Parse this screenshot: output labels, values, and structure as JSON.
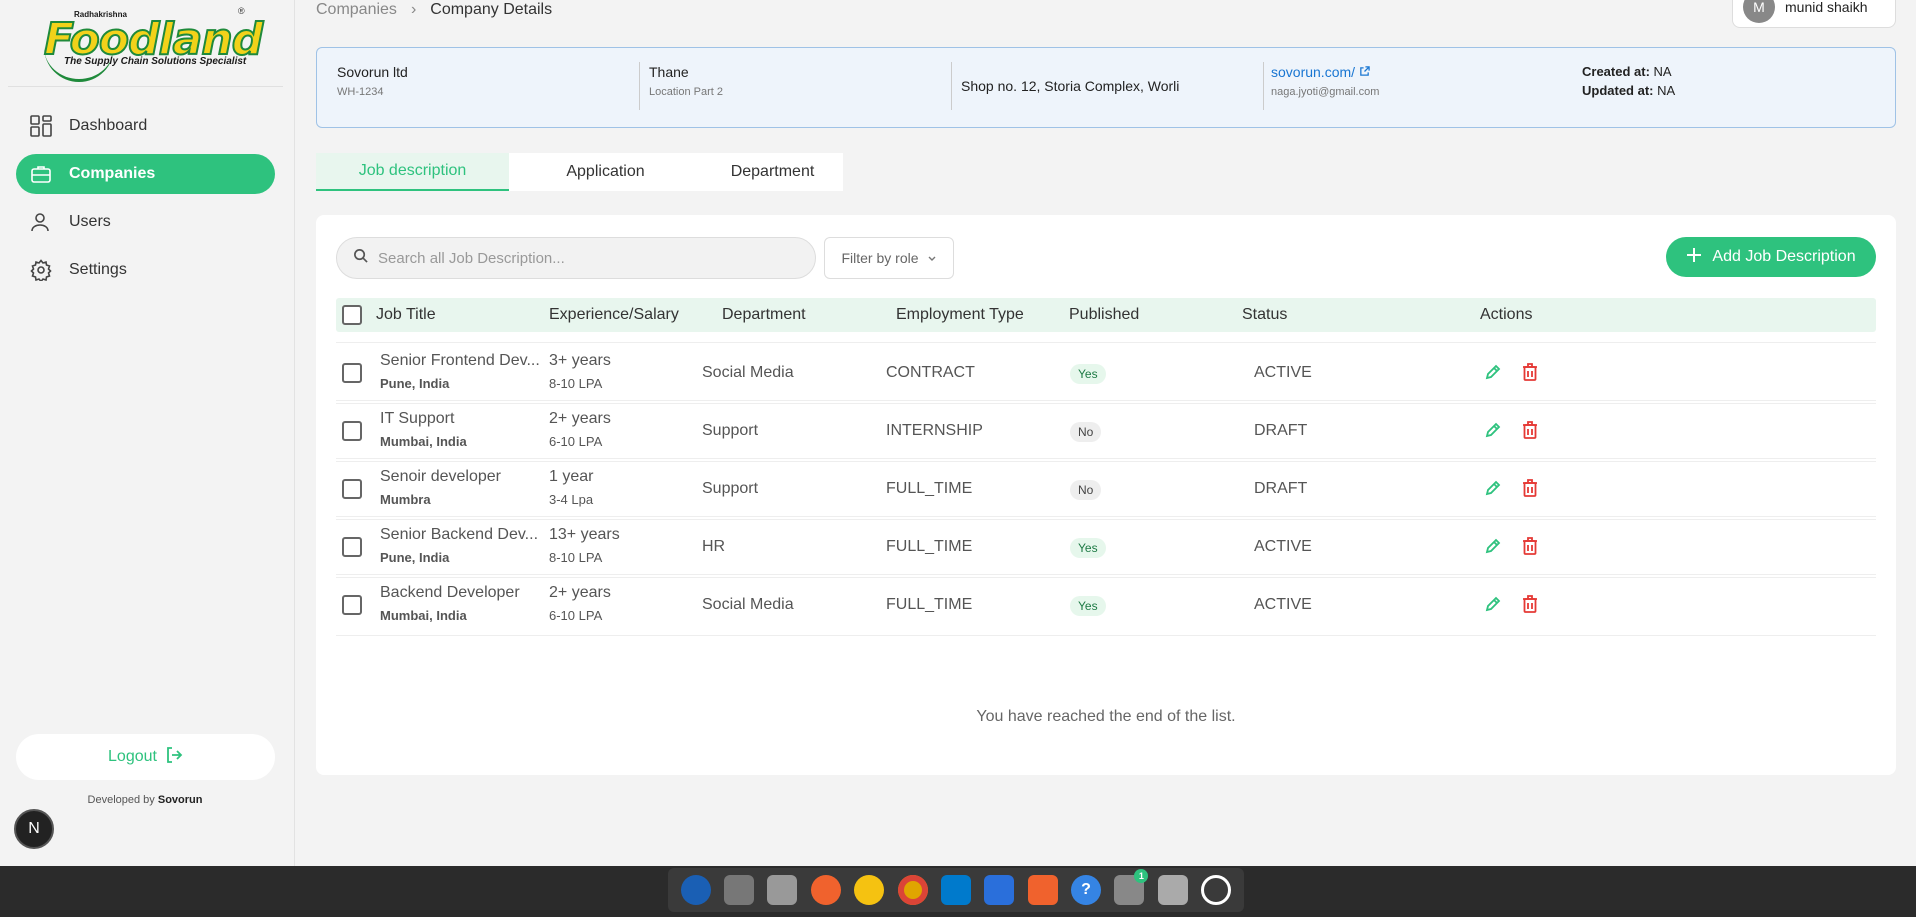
{
  "logo": {
    "small": "Radhakrishna",
    "brand": "Foodland",
    "reg": "®",
    "tagline": "The Supply Chain Solutions Specialist"
  },
  "sidebar": {
    "items": [
      {
        "label": "Dashboard",
        "icon": "dashboard-grid-icon"
      },
      {
        "label": "Companies",
        "icon": "briefcase-icon"
      },
      {
        "label": "Users",
        "icon": "user-icon"
      },
      {
        "label": "Settings",
        "icon": "gear-icon"
      }
    ],
    "logout": "Logout",
    "dev_prefix": "Developed by",
    "dev_name": "Sovorun",
    "badge": "N"
  },
  "breadcrumb": {
    "parent": "Companies",
    "sep": "›",
    "current": "Company Details"
  },
  "user": {
    "initial": "M",
    "name": "munid shaikh"
  },
  "company": {
    "name": "Sovorun ltd",
    "code": "WH-1234",
    "city": "Thane",
    "location": "Location Part 2",
    "address": "Shop no. 12, Storia Complex, Worli",
    "website": "sovorun.com/",
    "email": "naga.jyoti@gmail.com",
    "created_label": "Created at:",
    "created_value": "NA",
    "updated_label": "Updated at:",
    "updated_value": "NA"
  },
  "tabs": [
    "Job description",
    "Application",
    "Department"
  ],
  "toolbar": {
    "search_placeholder": "Search all Job Description...",
    "filter_label": "Filter by role",
    "add_label": "Add Job Description"
  },
  "table": {
    "headers": [
      "Job Title",
      "Experience/Salary",
      "Department",
      "Employment Type",
      "Published",
      "Status",
      "Actions"
    ],
    "rows": [
      {
        "title": "Senior Frontend Dev...",
        "location": "Pune, India",
        "exp": "3+ years",
        "salary": "8-10 LPA",
        "dept": "Social Media",
        "type": "CONTRACT",
        "published": "Yes",
        "status": "ACTIVE"
      },
      {
        "title": "IT Support",
        "location": "Mumbai, India",
        "exp": "2+ years",
        "salary": "6-10 LPA",
        "dept": "Support",
        "type": "INTERNSHIP",
        "published": "No",
        "status": "DRAFT"
      },
      {
        "title": "Senoir developer",
        "location": "Mumbra",
        "exp": "1 year",
        "salary": "3-4 Lpa",
        "dept": "Support",
        "type": "FULL_TIME",
        "published": "No",
        "status": "DRAFT"
      },
      {
        "title": "Senior Backend Dev...",
        "location": "Pune, India",
        "exp": "13+ years",
        "salary": "8-10 LPA",
        "dept": "HR",
        "type": "FULL_TIME",
        "published": "Yes",
        "status": "ACTIVE"
      },
      {
        "title": "Backend Developer",
        "location": "Mumbai, India",
        "exp": "2+ years",
        "salary": "6-10 LPA",
        "dept": "Social Media",
        "type": "FULL_TIME",
        "published": "Yes",
        "status": "ACTIVE"
      }
    ],
    "end_text": "You have reached the end of the list."
  },
  "colors": {
    "accent": "#2ec27e",
    "danger": "#e53935",
    "link": "#1976d2"
  },
  "taskbar": {
    "apps": [
      "thunderbird-icon",
      "files-icon",
      "clipboard-icon",
      "pen-icon",
      "music-icon",
      "chrome-icon",
      "vscode-icon",
      "document-icon",
      "app-store-icon",
      "help-icon",
      "settings-icon",
      "trash-icon",
      "apps-grid-icon"
    ],
    "notif": "1"
  }
}
